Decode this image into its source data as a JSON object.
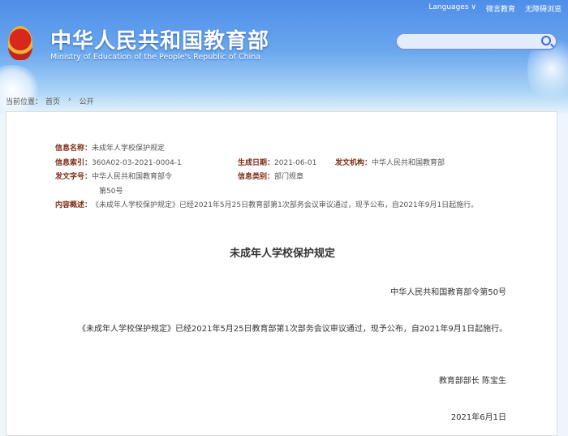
{
  "header": {
    "title_cn": "中华人民共和国教育部",
    "title_en": "Ministry of Education of the People's Republic of China",
    "links": [
      "Languages ∨",
      "微言教育",
      "无障碍浏览"
    ],
    "search_placeholder": ""
  },
  "breadcrumb": {
    "prefix": "当前位置：",
    "items": [
      "首页",
      "公开"
    ],
    "separator": "›"
  },
  "meta": {
    "name_label": "信息名称：",
    "name": "未成年人学校保护规定",
    "index_label": "信息索引：",
    "index": "360A02-03-2021-0004-1",
    "date_label": "生成日期：",
    "date": "2021-06-01",
    "org_label": "发文机构：",
    "org": "中华人民共和国教育部",
    "doc_no_label": "发文字号：",
    "doc_no": "中华人民共和国教育部令",
    "doc_no2": "第50号",
    "category_label": "信息类别：",
    "category": "部门规章",
    "summary_label": "内容概述：",
    "summary": "《未成年人学校保护规定》已经2021年5月25日教育部第1次部务会议审议通过，现予公布，自2021年9月1日起施行。"
  },
  "document": {
    "title": "未成年人学校保护规定",
    "order": "中华人民共和国教育部令第50号",
    "body": "《未成年人学校保护规定》已经2021年5月25日教育部第1次部务会议审议通过，现予公布，自2021年9月1日起施行。",
    "signature": "教育部部长 陈宝生",
    "date": "2021年6月1日"
  }
}
